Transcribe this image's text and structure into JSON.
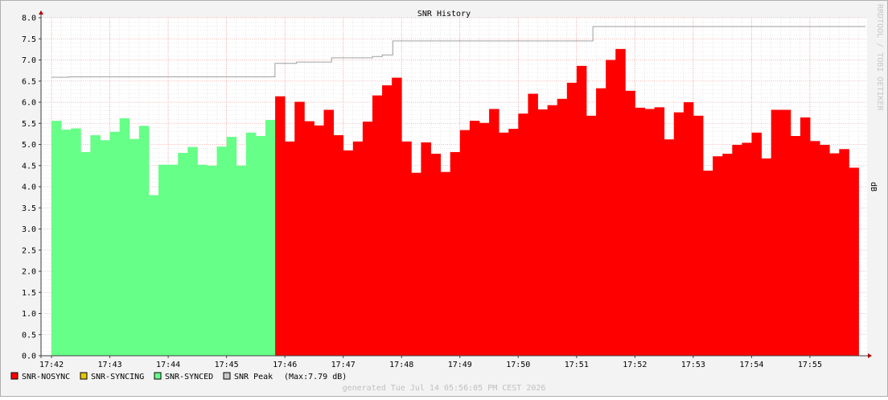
{
  "chart_data": {
    "type": "area",
    "title": "SNR History",
    "ylabel": "dB",
    "watermark": "RRDTOOL / TOBI OETIKER",
    "ylim": [
      0,
      8
    ],
    "y_ticks": [
      "0.0",
      "0.5",
      "1.0",
      "1.5",
      "2.0",
      "2.5",
      "3.0",
      "3.5",
      "4.0",
      "4.5",
      "5.0",
      "5.5",
      "6.0",
      "6.5",
      "7.0",
      "7.5",
      "8.0"
    ],
    "x_ticks": [
      "17:42",
      "17:43",
      "17:44",
      "17:45",
      "17:46",
      "17:47",
      "17:48",
      "17:49",
      "17:50",
      "17:51",
      "17:52",
      "17:53",
      "17:54",
      "17:55"
    ],
    "xlim_minutes": [
      -0.18,
      13.98
    ],
    "grid": true,
    "colors": {
      "nosync": "#ff0000",
      "syncing": "#e5c600",
      "synced": "#66ff88",
      "peak": "#a0a0a0",
      "grid_major": "#f2a0a0",
      "grid_minor": "#d8d8d8",
      "axis": "#b00000"
    },
    "series": [
      {
        "name": "SNR-SYNCED",
        "start_minute": 0.0,
        "step_minutes": 0.1667,
        "values": [
          5.56,
          5.35,
          5.38,
          4.82,
          5.22,
          5.1,
          5.3,
          5.62,
          5.13,
          5.44,
          3.8,
          4.52,
          4.52,
          4.8,
          4.94,
          4.52,
          4.5,
          4.95,
          5.18,
          4.5,
          5.28,
          5.2,
          5.58
        ]
      },
      {
        "name": "SNR-NOSYNC",
        "start_minute": 3.8333,
        "step_minutes": 0.1667,
        "values": [
          6.14,
          5.07,
          6.01,
          5.55,
          5.45,
          5.82,
          5.22,
          4.86,
          5.07,
          5.54,
          6.16,
          6.4,
          6.58,
          5.07,
          4.33,
          5.05,
          4.78,
          4.35,
          4.82,
          5.34,
          5.56,
          5.51,
          5.84,
          5.28,
          5.37,
          5.73,
          6.2,
          5.83,
          5.93,
          6.08,
          6.46,
          6.86,
          5.68,
          6.33,
          7.0,
          7.26,
          6.27,
          5.87,
          5.84,
          5.88,
          5.12,
          5.76,
          6.0,
          5.68,
          4.38,
          4.72,
          4.78,
          4.99,
          5.04,
          5.28,
          4.67,
          5.82,
          5.82,
          5.2,
          5.64,
          5.08,
          4.99,
          4.79,
          4.89,
          4.45
        ]
      },
      {
        "name": "SNR-SYNCING",
        "values": []
      },
      {
        "name": "SNR Peak",
        "steps": [
          {
            "from": 0.0,
            "value": 6.59
          },
          {
            "from": 0.3,
            "value": 6.6
          },
          {
            "from": 3.83,
            "value": 6.92
          },
          {
            "from": 4.2,
            "value": 6.95
          },
          {
            "from": 4.8,
            "value": 7.05
          },
          {
            "from": 5.5,
            "value": 7.08
          },
          {
            "from": 5.67,
            "value": 7.12
          },
          {
            "from": 5.85,
            "value": 7.45
          },
          {
            "from": 6.5,
            "value": 7.45
          },
          {
            "from": 9.28,
            "value": 7.79
          },
          {
            "from": 13.95,
            "value": 7.79
          }
        ]
      }
    ]
  },
  "legend": {
    "items": [
      {
        "label": "SNR-NOSYNC",
        "color": "#ff0000"
      },
      {
        "label": "SNR-SYNCING",
        "color": "#e5c600"
      },
      {
        "label": "SNR-SYNCED",
        "color": "#66ff88"
      },
      {
        "label": "SNR Peak",
        "color": "#c8c8c8"
      }
    ],
    "peak_max": "(Max:7.79 dB)"
  },
  "footer": "generated Tue Jul 14 05:56:05 PM CEST 2026"
}
